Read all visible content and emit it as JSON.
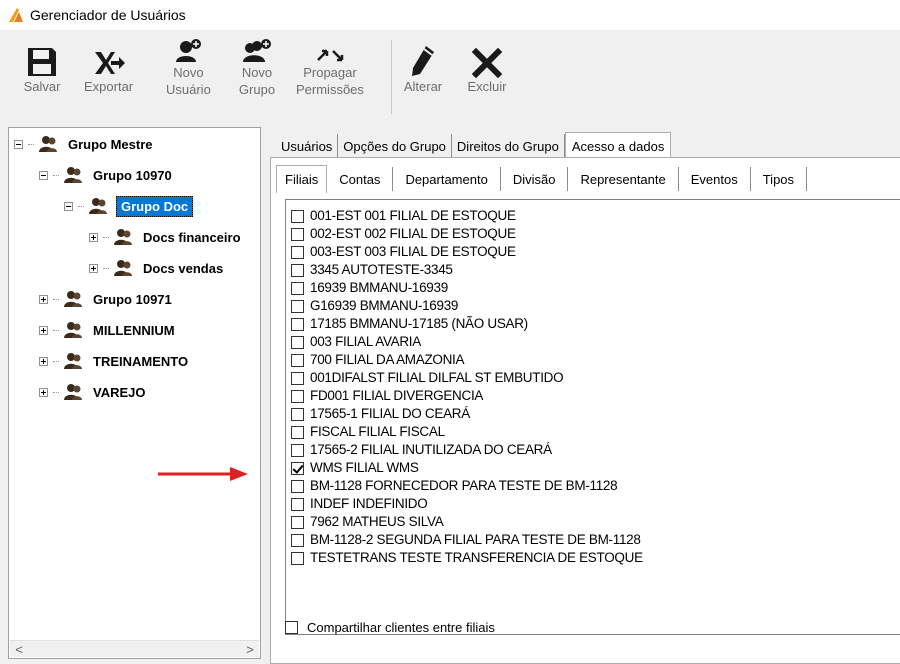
{
  "window": {
    "title": "Gerenciador de Usuários"
  },
  "toolbar": {
    "buttons": [
      {
        "label": "Salvar",
        "icon": "save-icon"
      },
      {
        "label": "Exportar",
        "icon": "export-icon"
      },
      {
        "label": "Novo\nUsuário",
        "icon": "new-user-icon"
      },
      {
        "label": "Novo\nGrupo",
        "icon": "new-group-icon"
      },
      {
        "label": "Propagar\nPermissões",
        "icon": "propagate-icon"
      },
      {
        "label": "Alterar",
        "icon": "pencil-icon"
      },
      {
        "label": "Excluir",
        "icon": "delete-icon"
      }
    ]
  },
  "tree": {
    "nodes": [
      {
        "label": "Grupo Mestre",
        "expanded": true
      },
      {
        "label": "Grupo 10970",
        "expanded": true
      },
      {
        "label": "Grupo Doc",
        "expanded": true,
        "selected": true
      },
      {
        "label": "Docs financeiro",
        "expanded": false
      },
      {
        "label": "Docs vendas",
        "expanded": false
      },
      {
        "label": "Grupo 10971",
        "expanded": false
      },
      {
        "label": "MILLENNIUM",
        "expanded": false
      },
      {
        "label": "TREINAMENTO",
        "expanded": false
      },
      {
        "label": "VAREJO",
        "expanded": false
      }
    ]
  },
  "tabs": {
    "items": [
      "Usuários",
      "Opções do Grupo",
      "Direitos do Grupo",
      "Acesso a dados"
    ],
    "active": "Acesso a dados"
  },
  "subtabs": {
    "items": [
      "Filiais",
      "Contas",
      "Departamento",
      "Divisão",
      "Representante",
      "Eventos",
      "Tipos"
    ],
    "active": "Filiais"
  },
  "filiais": [
    {
      "label": "001-EST 001 FILIAL DE ESTOQUE",
      "checked": false
    },
    {
      "label": "002-EST 002 FILIAL DE ESTOQUE",
      "checked": false
    },
    {
      "label": "003-EST 003 FILIAL DE ESTOQUE",
      "checked": false
    },
    {
      "label": "3345 AUTOTESTE-3345",
      "checked": false
    },
    {
      "label": "16939 BMMANU-16939",
      "checked": false
    },
    {
      "label": "G16939 BMMANU-16939",
      "checked": false
    },
    {
      "label": "17185 BMMANU-17185 (NÃO USAR)",
      "checked": false
    },
    {
      "label": "003 FILIAL AVARIA",
      "checked": false
    },
    {
      "label": "700 FILIAL DA AMAZONIA",
      "checked": false
    },
    {
      "label": "001DIFALST FILIAL DILFAL ST EMBUTIDO",
      "checked": false
    },
    {
      "label": "FD001 FILIAL DIVERGENCIA",
      "checked": false
    },
    {
      "label": "17565-1 FILIAL DO CEARÁ",
      "checked": false
    },
    {
      "label": "FISCAL FILIAL FISCAL",
      "checked": false
    },
    {
      "label": "17565-2 FILIAL INUTILIZADA DO CEARÁ",
      "checked": false
    },
    {
      "label": "WMS FILIAL WMS",
      "checked": true
    },
    {
      "label": "BM-1128 FORNECEDOR PARA TESTE DE BM-1128",
      "checked": false
    },
    {
      "label": "INDEF INDEFINIDO",
      "checked": false
    },
    {
      "label": "7962 MATHEUS SILVA",
      "checked": false
    },
    {
      "label": "BM-1128-2 SEGUNDA FILIAL PARA TESTE DE BM-1128",
      "checked": false
    },
    {
      "label": "TESTETRANS TESTE TRANSFERENCIA DE ESTOQUE",
      "checked": false
    }
  ],
  "share_clients": {
    "label": "Compartilhar clientes entre filiais",
    "checked": false
  },
  "colors": {
    "selection": "#0078d7",
    "annotation_arrow": "#e02020",
    "app_icon": "#f39c12"
  }
}
